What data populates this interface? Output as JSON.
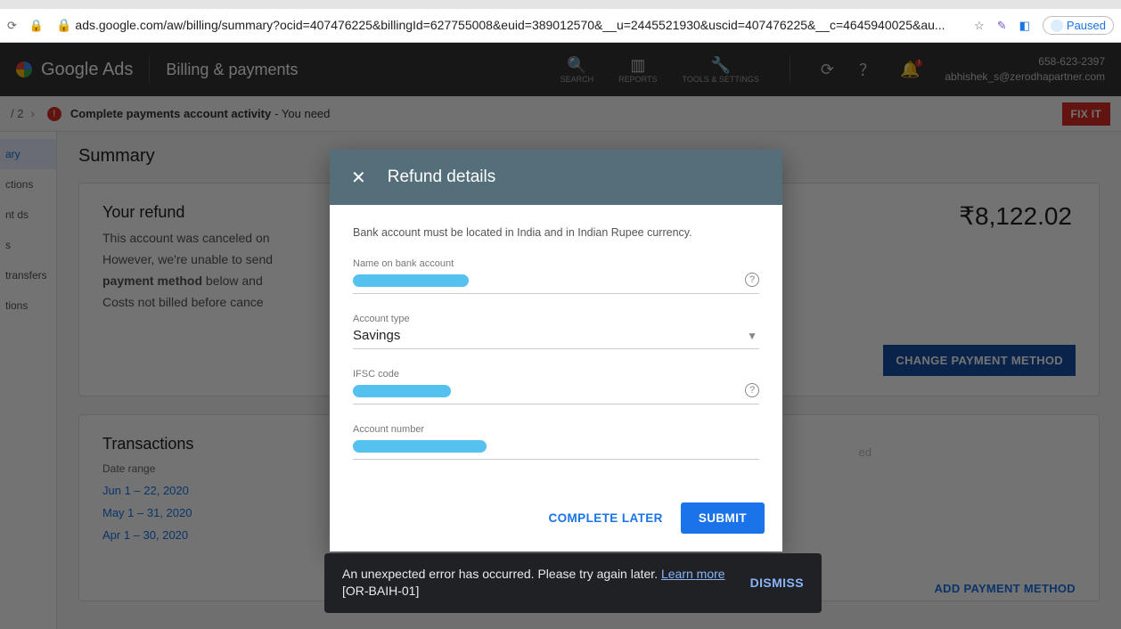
{
  "browser": {
    "url_display": "ads.google.com/aw/billing/summary?ocid=407476225&billingId=627755008&euid=389012570&__u=2445521930&uscid=407476225&__c=4645940025&au...",
    "paused": "Paused"
  },
  "header": {
    "product": "Google Ads",
    "page_title": "Billing & payments",
    "tools": {
      "search": "SEARCH",
      "reports": "REPORTS",
      "settings": "TOOLS & SETTINGS"
    },
    "account_id": "658-623-2397",
    "account_email": "abhishek_s@zerodhapartner.com"
  },
  "alert": {
    "breadcrumb": "/ 2",
    "bold": "Complete payments account activity",
    "rest": " - You need",
    "fix": "FIX IT"
  },
  "sidebar": {
    "items": [
      "ary",
      "ctions",
      "nt ds",
      "s",
      "transfers",
      "tions"
    ]
  },
  "summary": {
    "heading": "Summary",
    "refund": {
      "title": "Your refund",
      "line1": "This account was canceled on",
      "line2_a": "However, we're unable to send",
      "line2_b": "payment method",
      "line2_c": " below and",
      "line3": "Costs not billed before cance",
      "amount": "₹8,122.02",
      "change_btn": "CHANGE PAYMENT METHOD"
    },
    "transactions": {
      "title": "Transactions",
      "label": "Date range",
      "d1": "Jun 1 – 22, 2020",
      "d2": "May 1 – 31, 2020",
      "d3": "Apr 1 – 30, 2020",
      "add_pm": "ADD PAYMENT METHOD",
      "ed_frag": "ed"
    }
  },
  "modal": {
    "title": "Refund details",
    "hint": "Bank account must be located in India and in Indian Rupee currency.",
    "name_label": "Name on bank account",
    "type_label": "Account type",
    "type_value": "Savings",
    "ifsc_label": "IFSC code",
    "acct_label": "Account number",
    "later": "COMPLETE LATER",
    "submit": "SUBMIT"
  },
  "toast": {
    "msg": "An unexpected error has occurred. Please try again later. ",
    "link": "Learn more",
    "code": "[OR-BAIH-01]",
    "dismiss": "DISMISS"
  }
}
